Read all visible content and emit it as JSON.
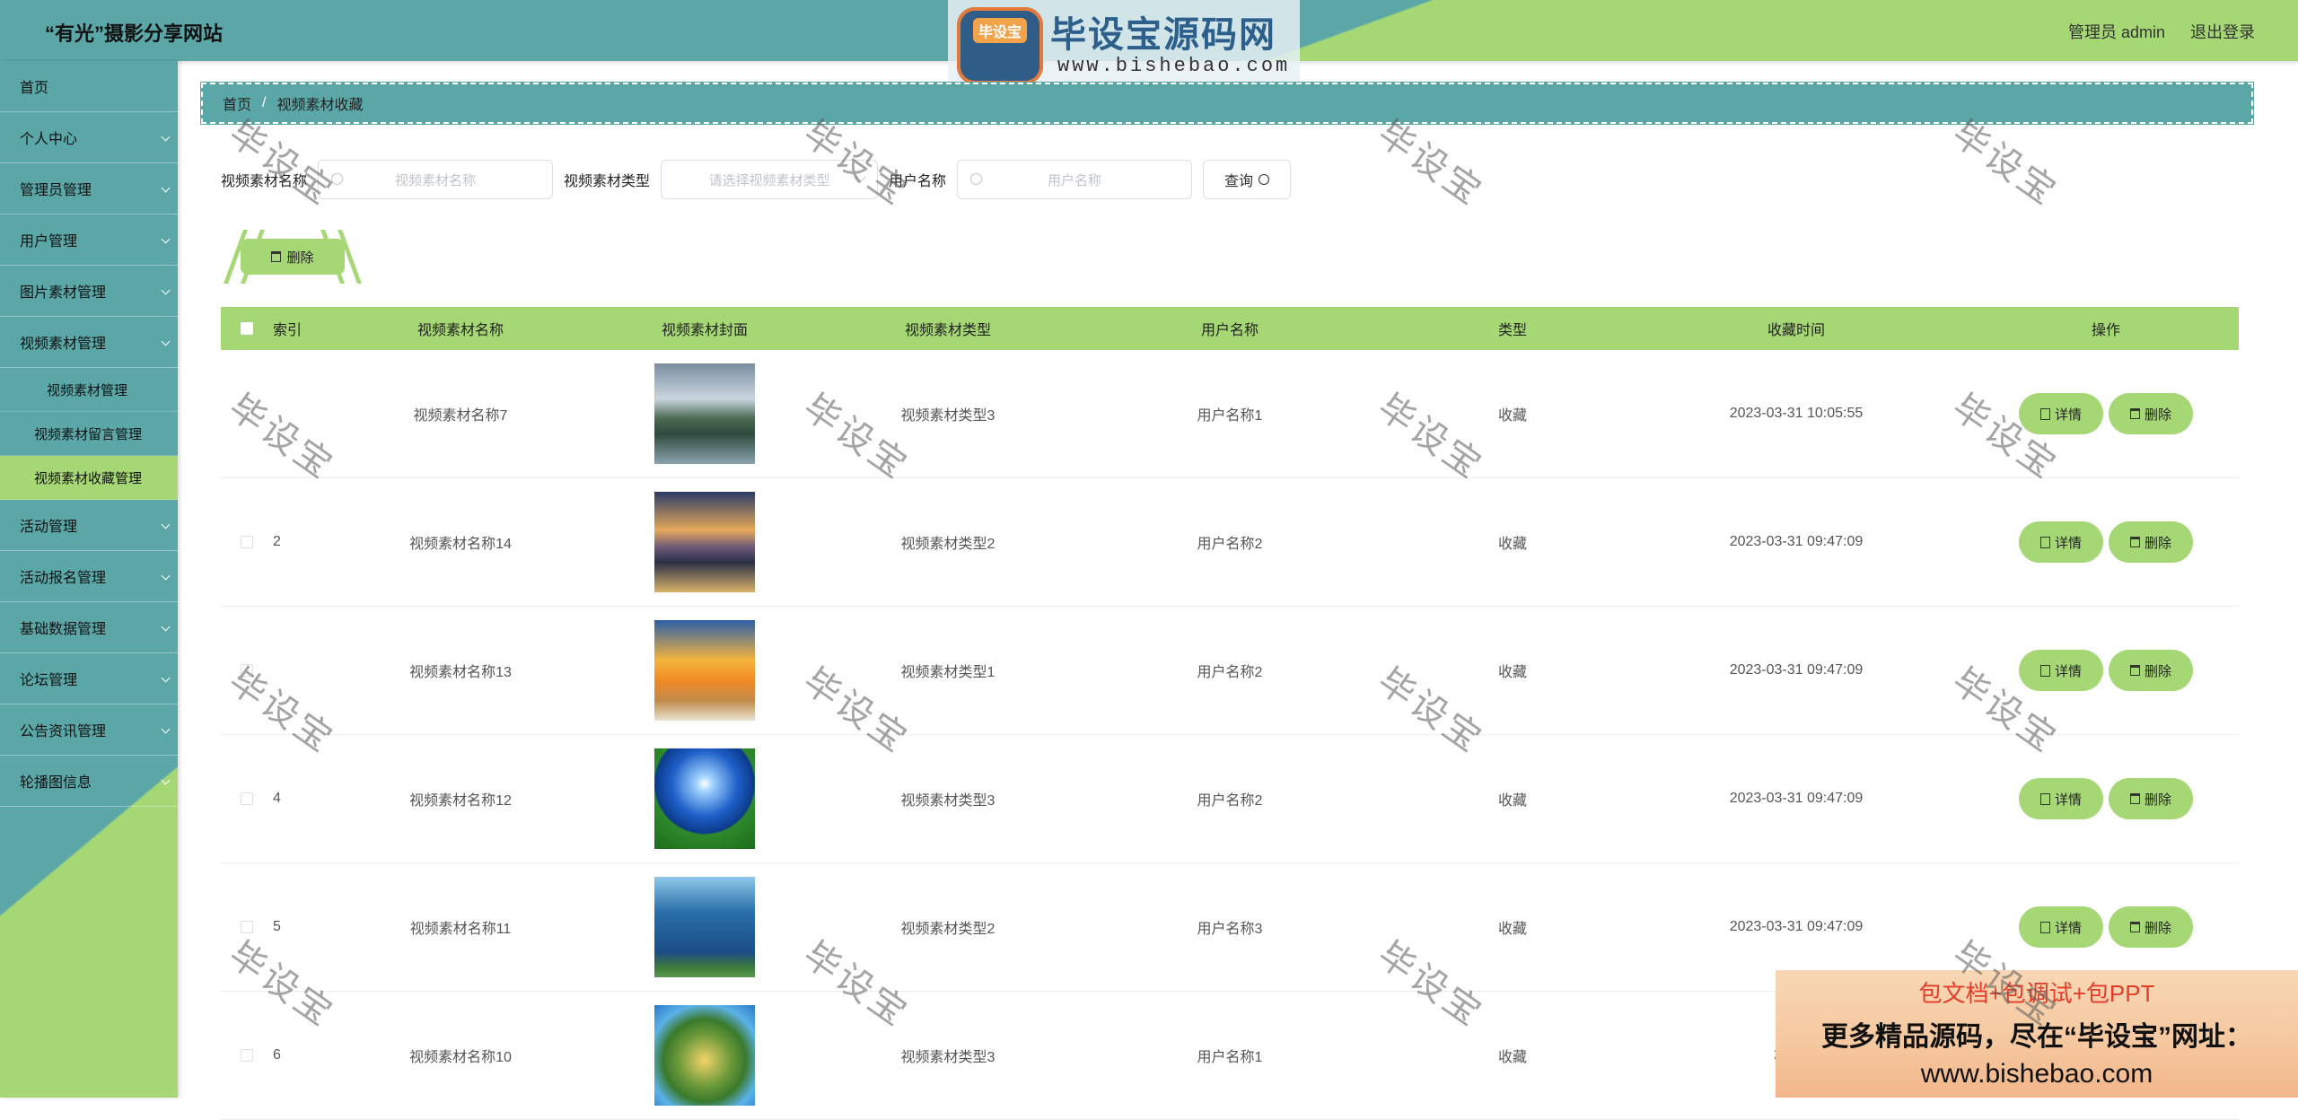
{
  "header": {
    "site_title": "“有光”摄影分享网站",
    "user_label": "管理员 admin",
    "logout": "退出登录"
  },
  "watermark_banner": {
    "logo_text": "毕设宝",
    "title": "毕设宝源码网",
    "url": "www.bishebao.com",
    "stamp": "毕设宝"
  },
  "sidebar": {
    "items": [
      {
        "label": "首页"
      },
      {
        "label": "个人中心"
      },
      {
        "label": "管理员管理"
      },
      {
        "label": "用户管理"
      },
      {
        "label": "图片素材管理"
      },
      {
        "label": "视频素材管理"
      }
    ],
    "sub_items": [
      {
        "label": "视频素材管理"
      },
      {
        "label": "视频素材留言管理"
      },
      {
        "label": "视频素材收藏管理"
      }
    ],
    "items_after": [
      {
        "label": "活动管理"
      },
      {
        "label": "活动报名管理"
      },
      {
        "label": "基础数据管理"
      },
      {
        "label": "论坛管理"
      },
      {
        "label": "公告资讯管理"
      },
      {
        "label": "轮播图信息"
      }
    ]
  },
  "breadcrumb": {
    "home": "首页",
    "current": "视频素材收藏"
  },
  "search": {
    "name_label": "视频素材名称",
    "name_placeholder": "视频素材名称",
    "type_label": "视频素材类型",
    "type_placeholder": "请选择视频素材类型",
    "user_label": "用户名称",
    "user_placeholder": "用户名称",
    "query_button": "查询"
  },
  "toolbar": {
    "delete_label": "删除"
  },
  "table": {
    "headers": [
      "索引",
      "视频素材名称",
      "视频素材封面",
      "视频素材类型",
      "用户名称",
      "类型",
      "收藏时间",
      "操作"
    ],
    "detail_label": "详情",
    "delete_label": "删除",
    "rows": [
      {
        "index": "",
        "name": "视频素材名称7",
        "type": "视频素材类型3",
        "user": "用户名称1",
        "kind": "收藏",
        "time": "2023-03-31 10:05:55"
      },
      {
        "index": "2",
        "name": "视频素材名称14",
        "type": "视频素材类型2",
        "user": "用户名称2",
        "kind": "收藏",
        "time": "2023-03-31 09:47:09"
      },
      {
        "index": "",
        "name": "视频素材名称13",
        "type": "视频素材类型1",
        "user": "用户名称2",
        "kind": "收藏",
        "time": "2023-03-31 09:47:09"
      },
      {
        "index": "4",
        "name": "视频素材名称12",
        "type": "视频素材类型3",
        "user": "用户名称2",
        "kind": "收藏",
        "time": "2023-03-31 09:47:09"
      },
      {
        "index": "5",
        "name": "视频素材名称11",
        "type": "视频素材类型2",
        "user": "用户名称3",
        "kind": "收藏",
        "time": "2023-03-31 09:47:09"
      },
      {
        "index": "6",
        "name": "视频素材名称10",
        "type": "视频素材类型3",
        "user": "用户名称1",
        "kind": "收藏",
        "time": "2023-0"
      }
    ]
  },
  "ad": {
    "line1": "包文档+包调试+包PPT",
    "line2": "更多精品源码，尽在“毕设宝”网址：",
    "line3": "www.bishebao.com"
  },
  "colors": {
    "teal": "#5ba7a8",
    "green": "#a6d775"
  }
}
